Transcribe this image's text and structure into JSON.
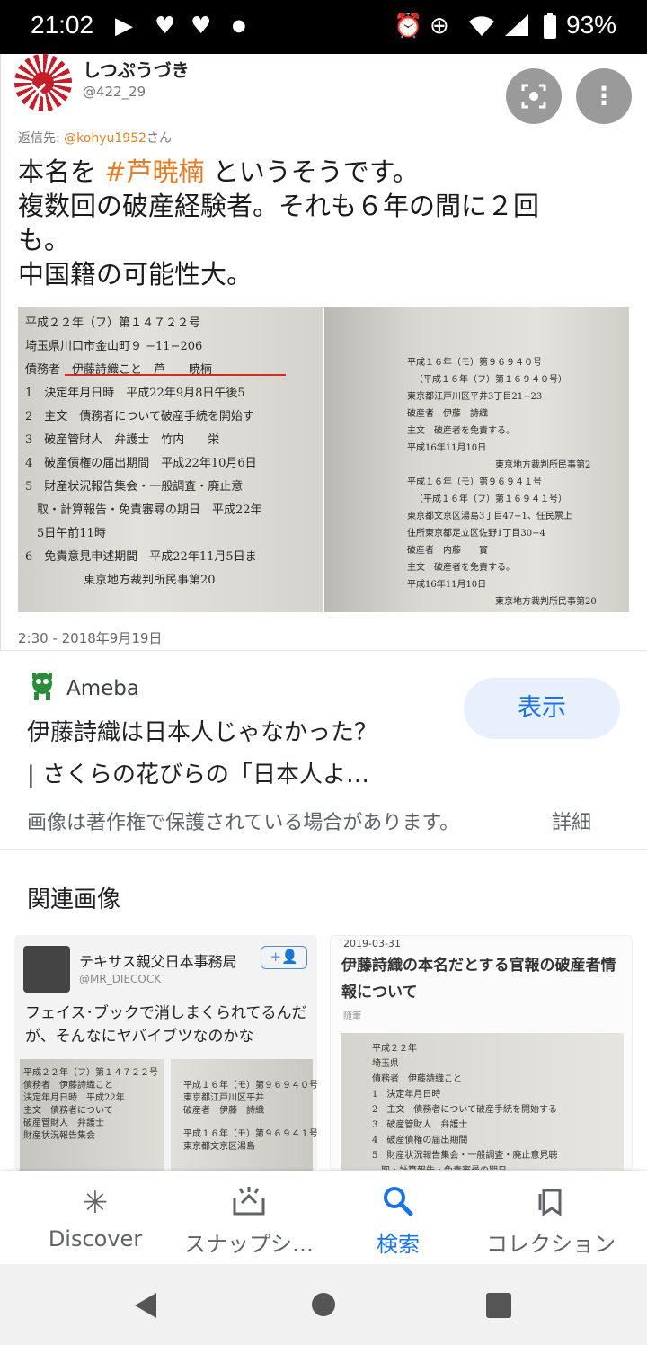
{
  "status_bar": {
    "time": "21:02",
    "battery": "93%",
    "icons": [
      "youtube-icon",
      "heart-icon",
      "heart-icon",
      "dot-icon",
      "alarm-icon",
      "data-saver-icon",
      "wifi-icon",
      "signal-icon",
      "battery-icon"
    ]
  },
  "tweet": {
    "account_name": "しつぷうづき",
    "handle": "@422_29",
    "reply_prefix": "返信先: ",
    "reply_mention": "@kohyu1952",
    "reply_suffix": "さん",
    "line1_pre": "本名を ",
    "line1_hashtag": "#芦暁楠",
    "line1_post": " というそうです。",
    "line2": "複数回の破産経験者。それも６年の間に２回",
    "line3": "も。",
    "line4": "中国籍の可能性大。",
    "timestamp": "2:30 - 2018年9月19日",
    "doc_left": [
      "平成２２年（フ）第１４７２２号",
      "埼玉県川口市金山町９ −11−206",
      "債務者　伊藤詩織こと　芦　　暁楠",
      "1　決定年月日時　平成22年9月8日午後5",
      "2　主文　債務者について破産手続を開始す",
      "3　破産管財人　弁護士　竹内　　栄",
      "4　破産債権の届出期間　平成22年10月6日",
      "5　財産状況報告集会・一般調査・廃止意",
      "　取・計算報告・免責審尋の期日　平成22年",
      "　5日午前11時",
      "6　免責意見申述期間　平成22年11月5日ま",
      "　　　　　東京地方裁判所民事第20"
    ],
    "doc_right": [
      "平成１６年（モ）第９６９４０号",
      "（平成１６年（フ）第１６９４０号）",
      "東京都江戸川区平井3丁目21−23",
      "破産者　伊藤　詩織",
      "主文　破産者を免責する。",
      "平成16年11月10日",
      "東京地方裁判所民事第2",
      "平成１６年（モ）第９６９４１号",
      "（平成１６年（フ）第１６９４１号）",
      "東京都文京区湯島3丁目47−1、任民票上",
      "住所東京都足立区佐野1丁目30−4",
      "破産者　内藤　　實",
      "主文　破産者を免責する。",
      "平成16年11月10日",
      "東京地方裁判所民事第20"
    ]
  },
  "result": {
    "source": "Ameba",
    "title_line1": "伊藤詩織は日本人じゃなかった？",
    "title_line2": "| さくらの花びらの「日本人よ…",
    "visit_label": "表示",
    "copyright_notice": "画像は著作権で保護されている場合があります。",
    "details_link": "詳細"
  },
  "related": {
    "heading": "関連画像",
    "thumb1": {
      "name": "テキサス親父日本事務局",
      "handle": "@MR_DIECOCK",
      "follow_label": "+👤",
      "text": "フェイス･ブックで消しまくられてるんだが、そんなにヤバイブツなのかな"
    },
    "thumb2": {
      "date": "2019-03-31",
      "title": "伊藤詩織の本名だとする官報の破産者情報について",
      "category": "随筆",
      "doc_lines": [
        "平成２２年",
        "埼玉県",
        "債務者　伊藤詩織こと",
        "1　決定年月日時",
        "2　主文　債務者について破産手続を開始する",
        "3　破産管財人　弁護士",
        "4　破産債権の届出期間",
        "5　財産状況報告集会・一般調査・廃止意見聴",
        "　取・計算報告・免責審尋の期日"
      ]
    }
  },
  "bottom_nav": {
    "items": [
      {
        "label": "Discover",
        "icon": "asterisk-icon",
        "glyph": "✳"
      },
      {
        "label": "スナップシ…",
        "icon": "snapshot-icon",
        "glyph": "⊔"
      },
      {
        "label": "検索",
        "icon": "search-icon",
        "glyph": "🔍"
      },
      {
        "label": "コレクション",
        "icon": "bookmark-icon",
        "glyph": "⧉"
      }
    ],
    "active_index": 2
  },
  "colors": {
    "accent": "#1a73e8",
    "hashtag": "#e97b22",
    "visit_button_bg": "#e8f0fe"
  }
}
